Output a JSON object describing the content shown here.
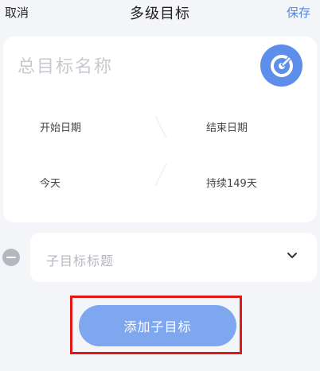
{
  "nav": {
    "cancel": "取消",
    "title": "多级目标",
    "save": "保存"
  },
  "goal": {
    "name_placeholder": "总目标名称",
    "icon": "target-icon",
    "start_label": "开始日期",
    "start_value": "今天",
    "end_label": "结束日期",
    "end_value": "持续149天"
  },
  "subgoal": {
    "title_placeholder": "子目标标题",
    "remove_icon": "minus-circle-icon",
    "expand_icon": "chevron-down-icon"
  },
  "actions": {
    "add_subgoal": "添加子目标"
  },
  "colors": {
    "accent": "#4f86e8",
    "button": "#7ea7ef",
    "highlight": "#e01818"
  }
}
